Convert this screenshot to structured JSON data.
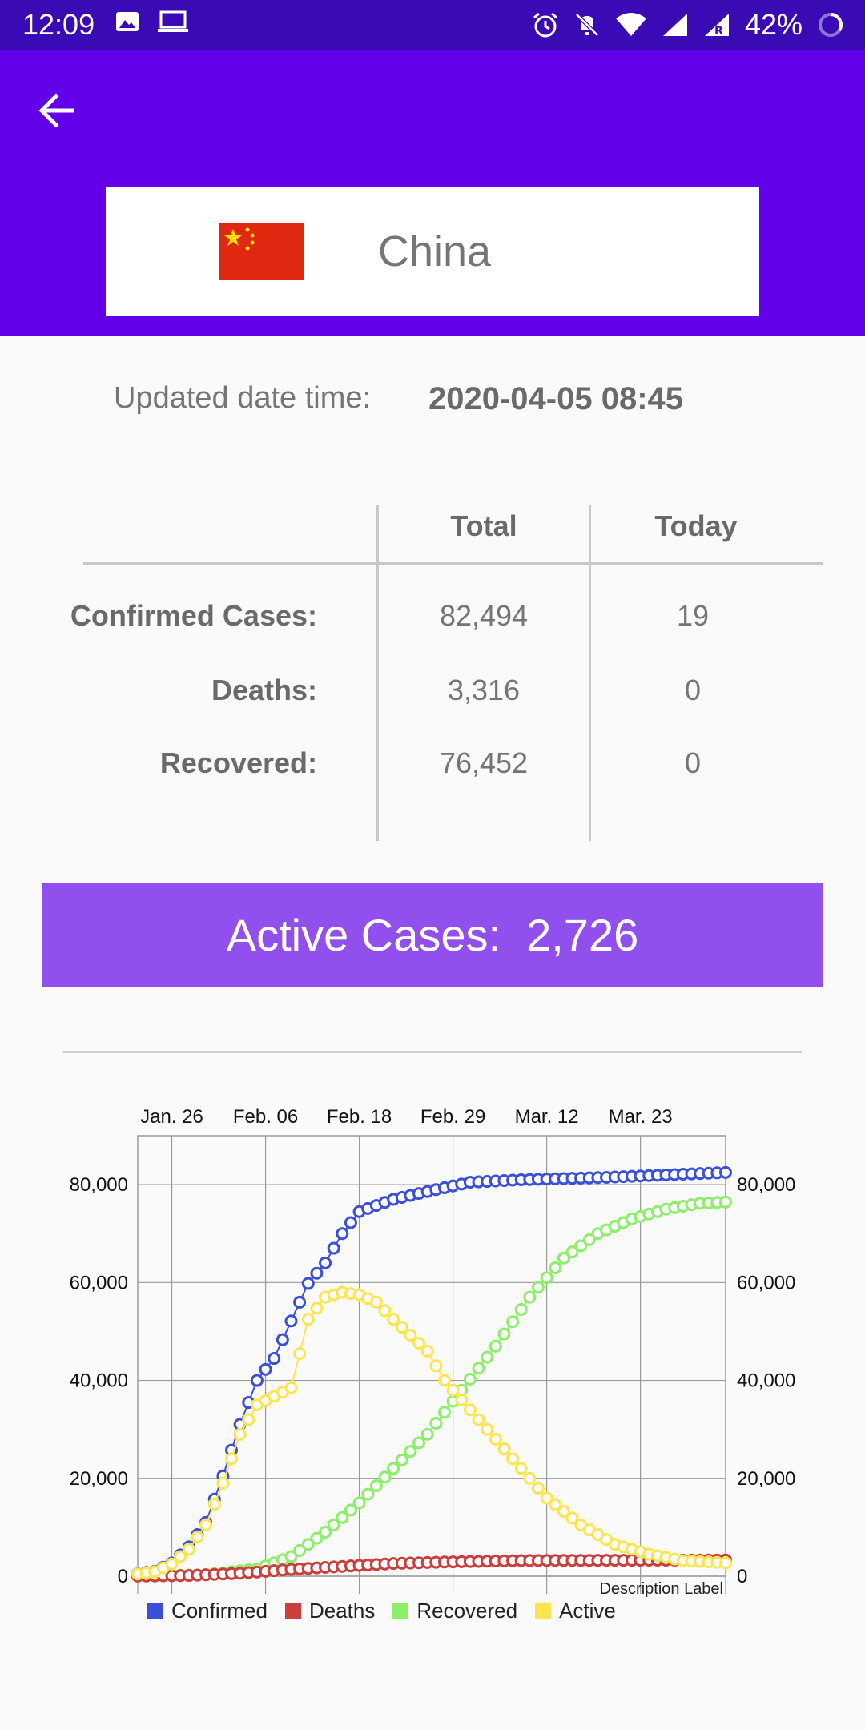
{
  "status_bar": {
    "time": "12:09",
    "battery": "42%",
    "icons": [
      "image-icon",
      "laptop-icon",
      "alarm-icon",
      "mute-icon",
      "wifi-icon",
      "signal-icon",
      "signal-roaming-icon",
      "battery-ring-icon"
    ]
  },
  "header": {
    "back_icon": "arrow-back-icon"
  },
  "country": {
    "name": "China",
    "flag": "china-flag",
    "flag_color": "#de2910",
    "star_color": "#ffde00"
  },
  "updated": {
    "label": "Updated date time:",
    "value": "2020-04-05 08:45"
  },
  "stats": {
    "columns": [
      "Total",
      "Today"
    ],
    "rows": [
      {
        "label": "Confirmed Cases:",
        "total": "82,494",
        "today": "19"
      },
      {
        "label": "Deaths:",
        "total": "3,316",
        "today": "0"
      },
      {
        "label": "Recovered:",
        "total": "76,452",
        "today": "0"
      }
    ]
  },
  "active": {
    "label": "Active Cases:",
    "value": "2,726",
    "color": "#9150ed"
  },
  "chart_data": {
    "type": "line",
    "x_tick_labels": [
      "Jan. 26",
      "Feb. 06",
      "Feb. 18",
      "Feb. 29",
      "Mar. 12",
      "Mar. 23"
    ],
    "x_tick_days": [
      4,
      15,
      26,
      37,
      48,
      59
    ],
    "xlim": [
      0,
      69
    ],
    "ylim": [
      0,
      90000
    ],
    "y_ticks": [
      0,
      20000,
      40000,
      60000,
      80000
    ],
    "y_tick_labels": [
      "0",
      "20,000",
      "40,000",
      "60,000",
      "80,000"
    ],
    "description": "Description Label",
    "grid": true,
    "legend_position": "bottom-left",
    "series": [
      {
        "name": "Confirmed",
        "color": "#3b4fd8",
        "keypoints": [
          [
            0,
            500
          ],
          [
            2,
            1000
          ],
          [
            4,
            2700
          ],
          [
            6,
            6000
          ],
          [
            8,
            11000
          ],
          [
            10,
            20500
          ],
          [
            12,
            31000
          ],
          [
            14,
            40000
          ],
          [
            16,
            44500
          ],
          [
            20,
            59800
          ],
          [
            22,
            64000
          ],
          [
            24,
            70000
          ],
          [
            26,
            74500
          ],
          [
            30,
            77000
          ],
          [
            35,
            79000
          ],
          [
            39,
            80500
          ],
          [
            45,
            81000
          ],
          [
            55,
            81500
          ],
          [
            62,
            82000
          ],
          [
            69,
            82494
          ]
        ]
      },
      {
        "name": "Deaths",
        "color": "#cc3d3d",
        "keypoints": [
          [
            0,
            20
          ],
          [
            6,
            150
          ],
          [
            12,
            600
          ],
          [
            18,
            1400
          ],
          [
            24,
            2000
          ],
          [
            30,
            2600
          ],
          [
            36,
            2900
          ],
          [
            45,
            3200
          ],
          [
            69,
            3316
          ]
        ]
      },
      {
        "name": "Recovered",
        "color": "#8cee6b",
        "keypoints": [
          [
            0,
            30
          ],
          [
            8,
            300
          ],
          [
            14,
            1500
          ],
          [
            18,
            4000
          ],
          [
            22,
            9000
          ],
          [
            26,
            15000
          ],
          [
            30,
            22000
          ],
          [
            34,
            29000
          ],
          [
            38,
            38000
          ],
          [
            42,
            47000
          ],
          [
            46,
            57000
          ],
          [
            50,
            65000
          ],
          [
            54,
            70000
          ],
          [
            58,
            73000
          ],
          [
            62,
            75000
          ],
          [
            66,
            76200
          ],
          [
            69,
            76452
          ]
        ]
      },
      {
        "name": "Active",
        "color": "#ffe54d",
        "keypoints": [
          [
            0,
            450
          ],
          [
            2,
            900
          ],
          [
            4,
            2500
          ],
          [
            6,
            5500
          ],
          [
            8,
            10500
          ],
          [
            10,
            19000
          ],
          [
            12,
            29000
          ],
          [
            14,
            35000
          ],
          [
            18,
            38500
          ],
          [
            20,
            52500
          ],
          [
            22,
            57000
          ],
          [
            24,
            58000
          ],
          [
            26,
            57500
          ],
          [
            28,
            56000
          ],
          [
            30,
            52500
          ],
          [
            34,
            46000
          ],
          [
            36,
            40000
          ],
          [
            40,
            32000
          ],
          [
            44,
            24000
          ],
          [
            48,
            16000
          ],
          [
            52,
            10500
          ],
          [
            56,
            6500
          ],
          [
            60,
            4500
          ],
          [
            64,
            3200
          ],
          [
            69,
            2726
          ]
        ]
      }
    ]
  }
}
